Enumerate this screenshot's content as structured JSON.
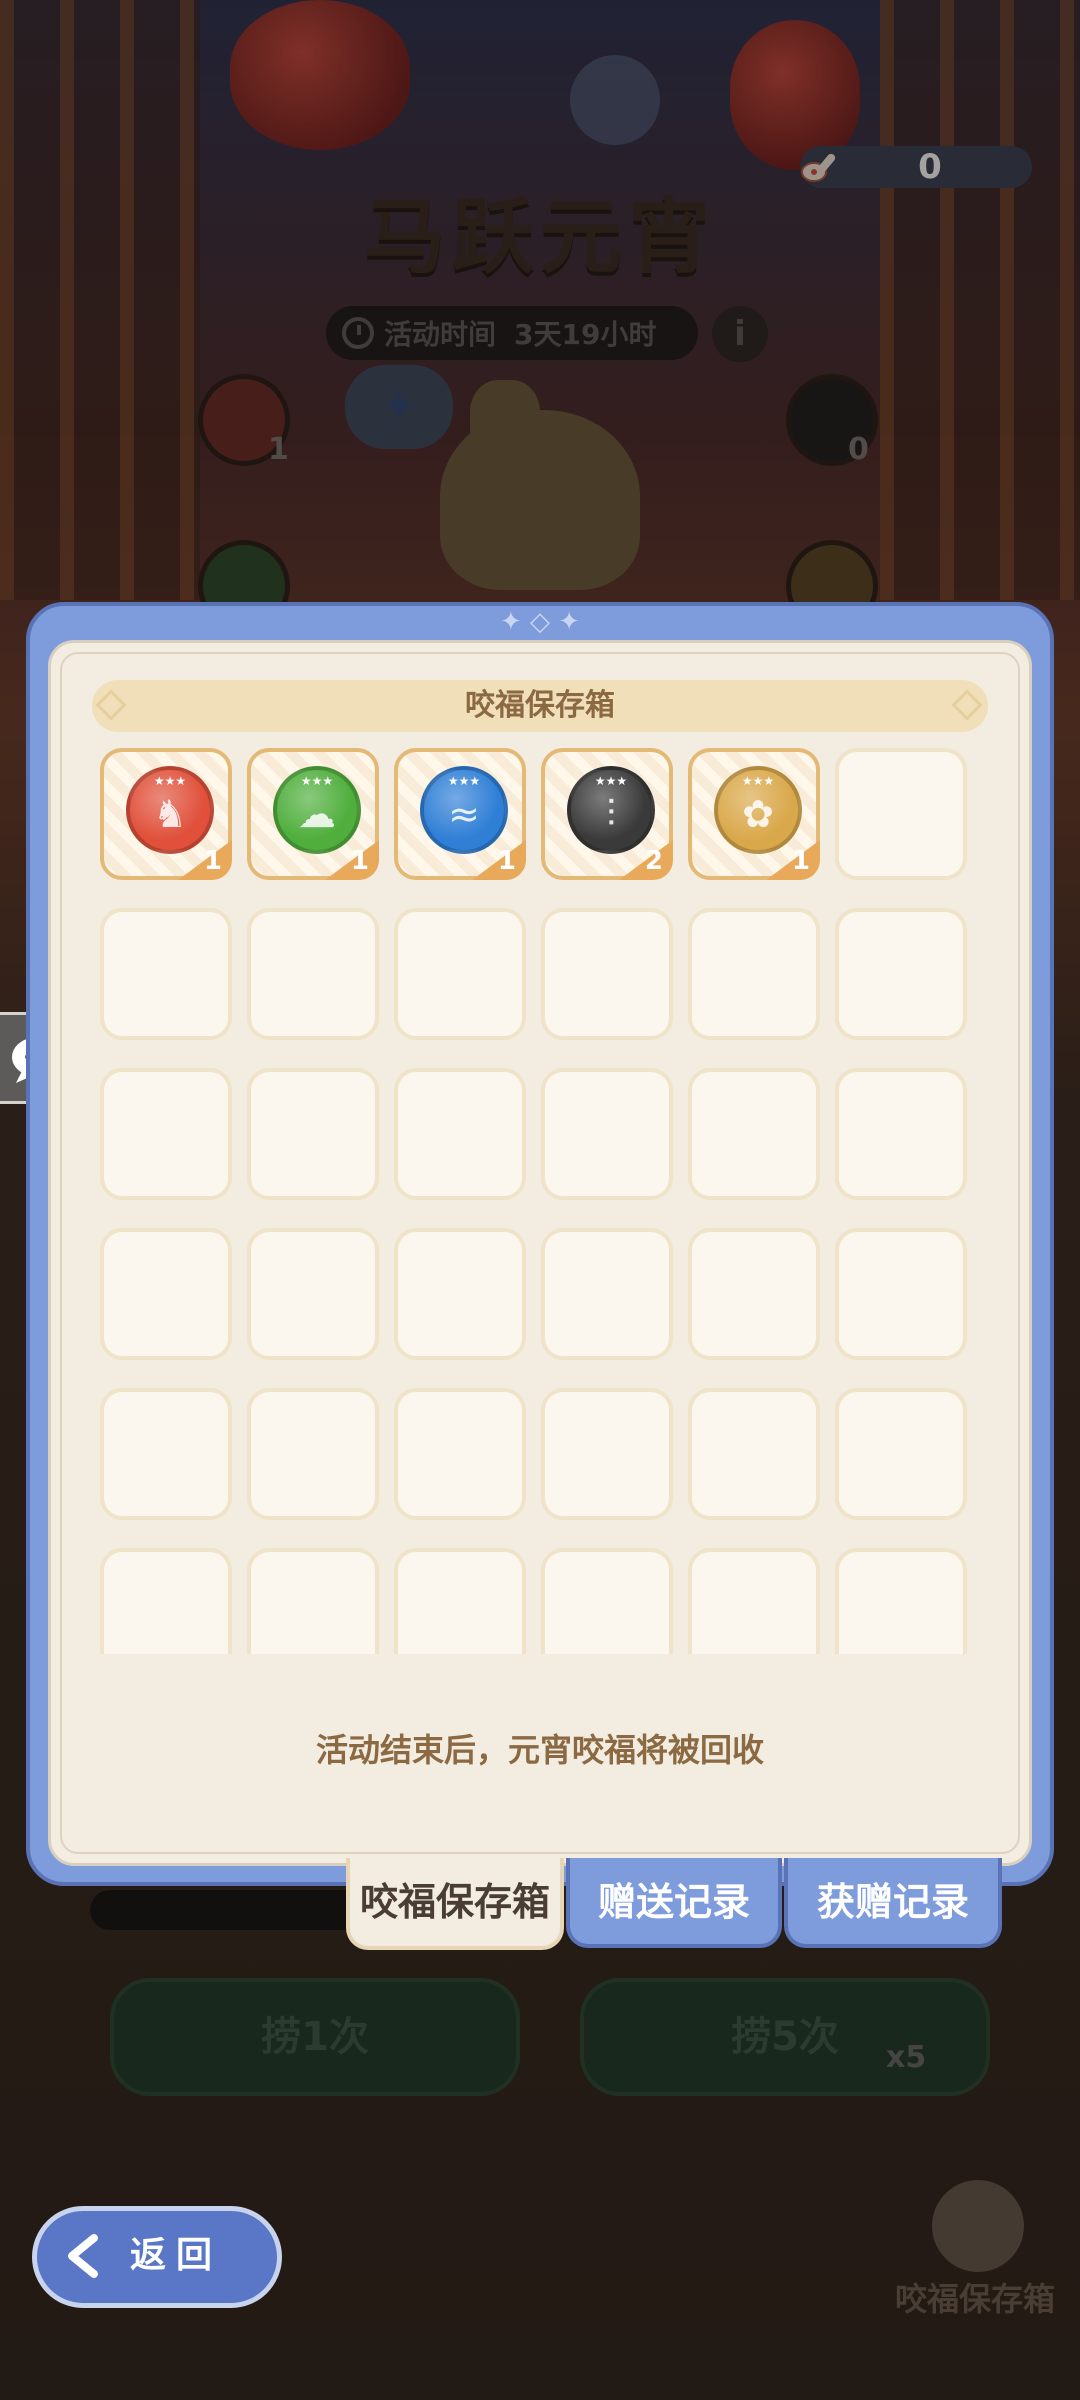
{
  "event": {
    "title": "马跃元宵",
    "time_label": "活动时间",
    "time_remaining": "3天19小时",
    "info_icon": "i"
  },
  "currency": {
    "icon": "spoon-icon",
    "count": "0"
  },
  "scene_tokens": [
    {
      "name": "red-horse-token",
      "count": "1",
      "color": "#8a2a24"
    },
    {
      "name": "black-bamboo-token",
      "count": "0",
      "color": "#2a2a2a"
    }
  ],
  "modal": {
    "title": "咬福保存箱",
    "note": "活动结束后，元宵咬福将被回收",
    "items": [
      {
        "name": "red-horse-token",
        "color": "#e0503a",
        "glyph": "♞",
        "count": "1"
      },
      {
        "name": "green-cloud-token",
        "color": "#4fae3c",
        "glyph": "☁",
        "count": "1"
      },
      {
        "name": "blue-wave-token",
        "color": "#2f7fd6",
        "glyph": "≈",
        "count": "1"
      },
      {
        "name": "black-bamboo-token",
        "color": "#3a3a3a",
        "glyph": "⫶",
        "count": "2"
      },
      {
        "name": "gold-wheat-token",
        "color": "#d9a84a",
        "glyph": "✿",
        "count": "1"
      }
    ],
    "empty_slots": 31
  },
  "tabs": [
    {
      "label": "咬福保存箱",
      "active": true
    },
    {
      "label": "赠送记录",
      "active": false
    },
    {
      "label": "获赠记录",
      "active": false
    }
  ],
  "actions": {
    "fish_once": "捞1次",
    "fish_five": "捞5次",
    "fish_five_badge": "x5",
    "back": "返回",
    "savebox_entry": "咬福保存箱"
  }
}
